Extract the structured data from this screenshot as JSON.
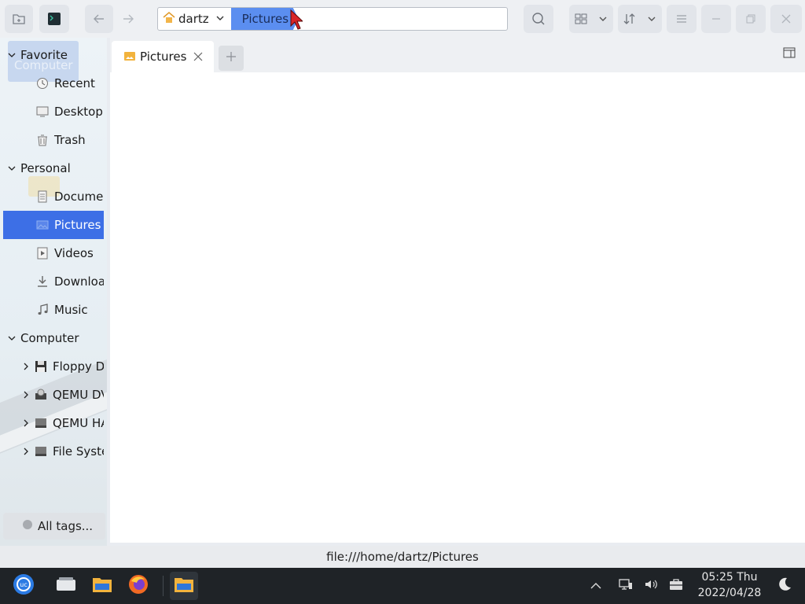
{
  "path_bar": {
    "home_crumb": "dartz",
    "active_crumb": "Pictures"
  },
  "sidebar": {
    "groups": [
      {
        "label": "Favorite"
      },
      {
        "label": "Personal"
      },
      {
        "label": "Computer"
      }
    ],
    "favorite_items": [
      {
        "label": "Recent",
        "icon": "clock-icon"
      },
      {
        "label": "Desktop",
        "icon": "desktop-icon"
      },
      {
        "label": "Trash",
        "icon": "trash-icon"
      }
    ],
    "personal_items": [
      {
        "label": "Documents",
        "icon": "document-icon"
      },
      {
        "label": "Pictures",
        "icon": "picture-icon"
      },
      {
        "label": "Videos",
        "icon": "video-icon"
      },
      {
        "label": "Downloads",
        "icon": "download-icon"
      },
      {
        "label": "Music",
        "icon": "music-icon"
      }
    ],
    "computer_items": [
      {
        "label": "Floppy Disk",
        "icon": "floppy-icon"
      },
      {
        "label": "QEMU DVD-ROM",
        "icon": "dvd-icon"
      },
      {
        "label": "QEMU HARDDISK",
        "icon": "harddisk-icon"
      },
      {
        "label": "File System",
        "icon": "filesystem-icon"
      }
    ],
    "ghost_label": "Computer",
    "all_tags_label": "All tags..."
  },
  "tabs": [
    {
      "label": "Pictures",
      "icon": "folder-pictures-icon"
    }
  ],
  "status": {
    "path": "file:///home/dartz/Pictures"
  },
  "taskbar": {
    "time": "05:25 Thu",
    "date": "2022/04/28"
  },
  "colors": {
    "accent": "#3d6fe6",
    "crumb_active": "#5b8ef0",
    "taskbar": "#1f2327"
  }
}
